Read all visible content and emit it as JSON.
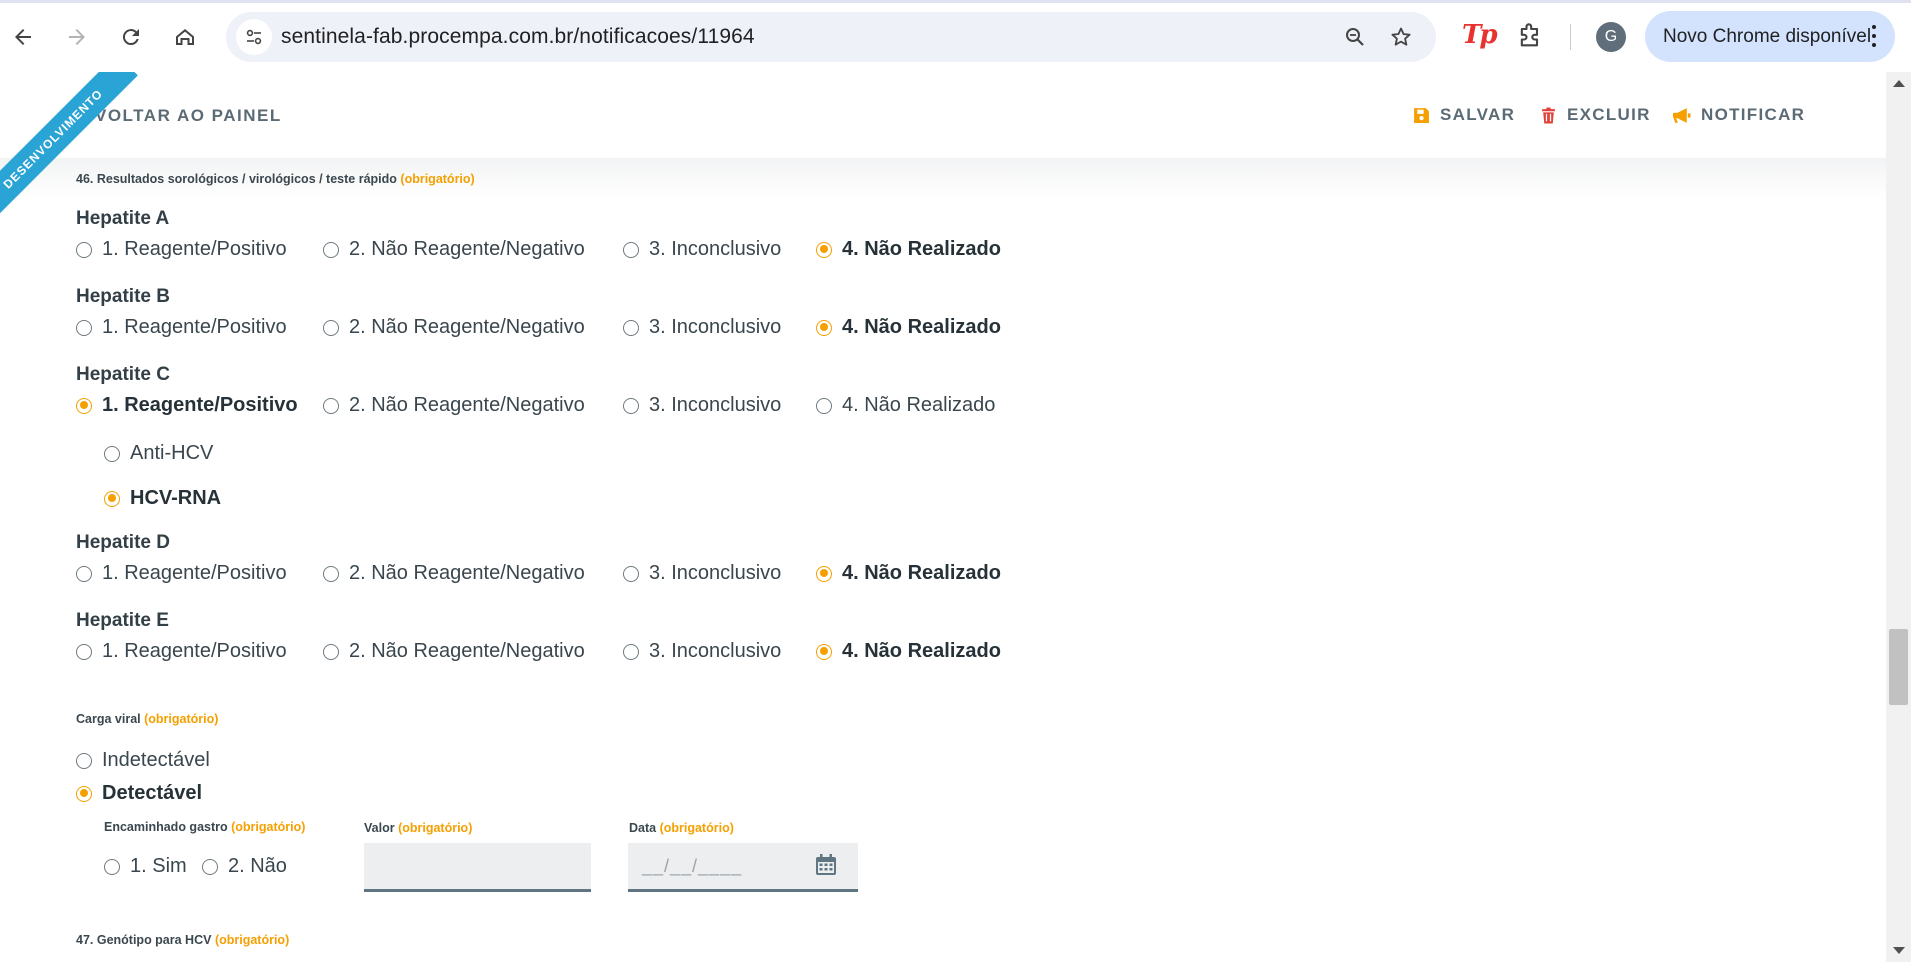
{
  "browser": {
    "url": "sentinela-fab.procempa.com.br/notificacoes/11964",
    "extension_label": "Tp",
    "avatar_initial": "G",
    "update_label": "Novo Chrome disponível"
  },
  "toolbar": {
    "ribbon": "DESENVOLVIMENTO",
    "back": "VOLTAR AO PAINEL",
    "save": "SALVAR",
    "delete": "EXCLUIR",
    "notify": "NOTIFICAR"
  },
  "form": {
    "required_tag": "(obrigatório)",
    "q46_title": "46. Resultados sorológicos / virológicos / teste rápido",
    "options": [
      "1. Reagente/Positivo",
      "2. Não Reagente/Negativo",
      "3. Inconclusivo",
      "4. Não Realizado"
    ],
    "hepatite_a": {
      "label": "Hepatite A",
      "selected": "4. Não Realizado"
    },
    "hepatite_b": {
      "label": "Hepatite B",
      "selected": "4. Não Realizado"
    },
    "hepatite_c": {
      "label": "Hepatite C",
      "selected": "1. Reagente/Positivo",
      "sub_options": [
        "Anti-HCV",
        "HCV-RNA"
      ],
      "sub_selected": "HCV-RNA"
    },
    "hepatite_d": {
      "label": "Hepatite D",
      "selected": "4. Não Realizado"
    },
    "hepatite_e": {
      "label": "Hepatite E",
      "selected": "4. Não Realizado"
    },
    "carga_viral": {
      "label": "Carga viral",
      "options": [
        "Indetectável",
        "Detectável"
      ],
      "selected": "Detectável"
    },
    "encaminhado": {
      "label": "Encaminhado gastro",
      "options": [
        "1. Sim",
        "2. Não"
      ],
      "selected": ""
    },
    "valor": {
      "label": "Valor",
      "value": ""
    },
    "data": {
      "label": "Data",
      "placeholder": "__/__/____"
    },
    "q47_title": "47. Genótipo para HCV"
  },
  "colors": {
    "accent": "#f5a000",
    "ribbon": "#29a4d4",
    "toolbar_text": "#5b6b75"
  }
}
